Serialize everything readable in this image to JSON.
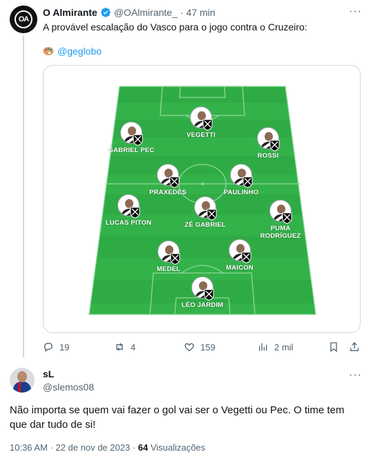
{
  "quoted_tweet": {
    "avatar_text": "OA",
    "name": "O Almirante",
    "handle": "@OAlmirante_",
    "separator": "·",
    "time": "47 min",
    "more": "···",
    "text": "A provável escalação do Vasco para o jogo contra o Cruzeiro:",
    "mention": "@geglobo",
    "media": {
      "players": [
        {
          "name": "VEGETTI"
        },
        {
          "name": "GABRIEL PEC"
        },
        {
          "name": "ROSSI"
        },
        {
          "name": "PRAXEDES"
        },
        {
          "name": "PAULINHO"
        },
        {
          "name": "LUCAS PITON"
        },
        {
          "name": "ZÉ GABRIEL"
        },
        {
          "name": "PUMA\nRODRÍGUEZ"
        },
        {
          "name": "MEDEL"
        },
        {
          "name": "MAICON"
        },
        {
          "name": "LÉO JARDIM"
        }
      ]
    },
    "actions": {
      "replies": "19",
      "reposts": "4",
      "likes": "159",
      "views": "2 mil"
    }
  },
  "reply_tweet": {
    "name": "sL",
    "handle": "@slemos08",
    "more": "···",
    "text": "Não importa se quem vai fazer o gol vai ser o Vegetti ou Pec. O time tem que dar tudo de si!",
    "timestamp": "10:36 AM · 22 de nov de 2023 ·",
    "views_count": "64",
    "views_label": "Visualizações"
  },
  "colors": {
    "field_light": "#34b24a",
    "field_dark": "#2aa23f",
    "link": "#1d9bf0",
    "muted": "#536471"
  },
  "icons": [
    "verified-badge-icon",
    "palette-icon",
    "reply-icon",
    "repost-icon",
    "like-icon",
    "views-icon",
    "bookmark-icon",
    "share-icon",
    "more-icon"
  ]
}
